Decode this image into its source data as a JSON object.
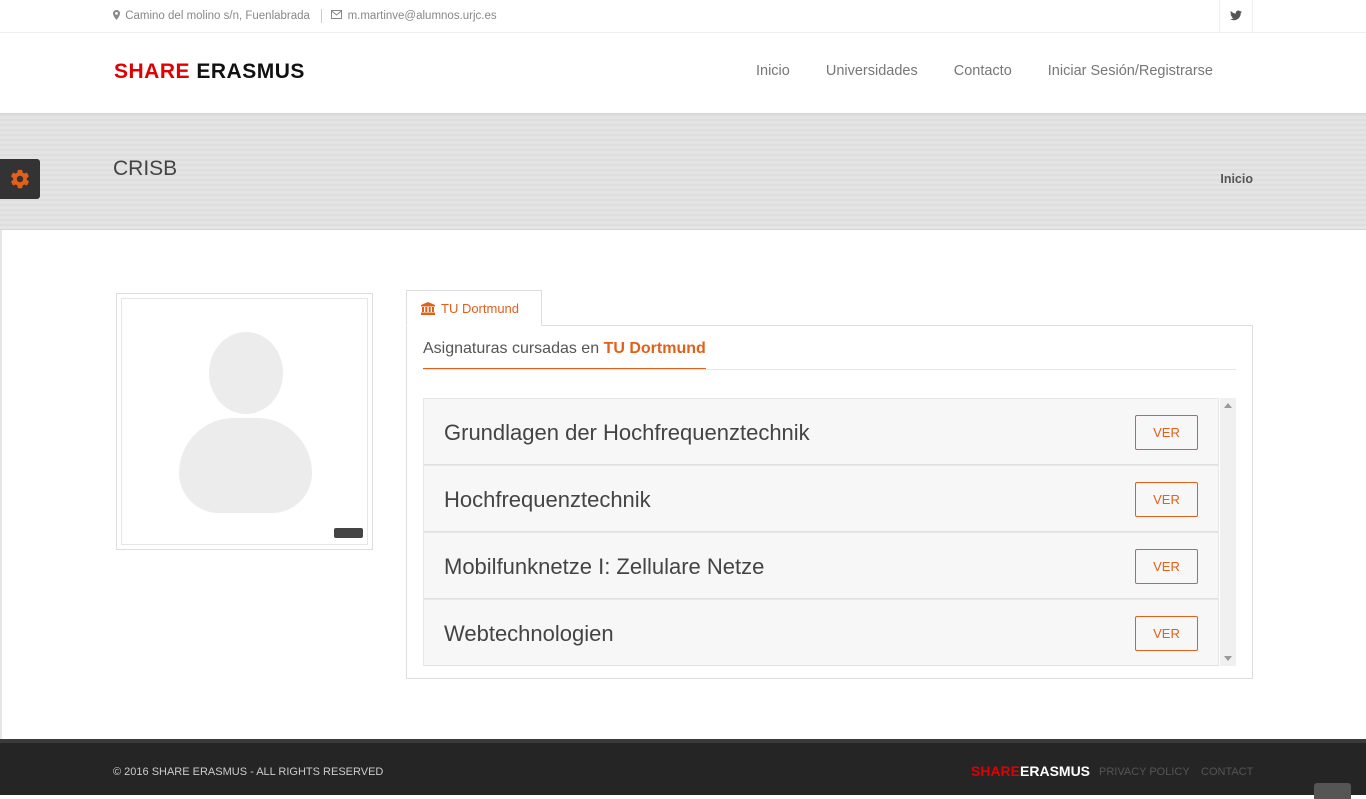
{
  "topbar": {
    "address": "Camino del molino s/n, Fuenlabrada",
    "email": "m.martinve@alumnos.urjc.es",
    "social_icon": "twitter-icon"
  },
  "header": {
    "logo_part1": "SHARE",
    "logo_part2": "ERASMUS",
    "nav": [
      "Inicio",
      "Universidades",
      "Contacto",
      "Iniciar Sesión/Registrarse"
    ]
  },
  "band": {
    "title": "CRISB",
    "breadcrumb": "Inicio"
  },
  "profile": {
    "tab_label": "TU Dortmund",
    "heading_prefix": "Asignaturas cursadas en",
    "heading_university": "TU Dortmund",
    "subjects": [
      {
        "name": "Grundlagen der Hochfrequenztechnik",
        "action": "VER"
      },
      {
        "name": "Hochfrequenztechnik",
        "action": "VER"
      },
      {
        "name": "Mobilfunknetze I: Zellulare Netze",
        "action": "VER"
      },
      {
        "name": "Webtechnologien",
        "action": "VER"
      }
    ]
  },
  "footer": {
    "copyright": "© 2016 SHARE ERASMUS - ALL RIGHTS RESERVED",
    "logo_part1": "SHARE",
    "logo_part2": "ERASMUS",
    "privacy": "PRIVACY POLICY",
    "contact": "CONTACT"
  },
  "colors": {
    "accent": "#e2601a",
    "brand_red": "#e10000",
    "footer_bg": "#252525"
  }
}
